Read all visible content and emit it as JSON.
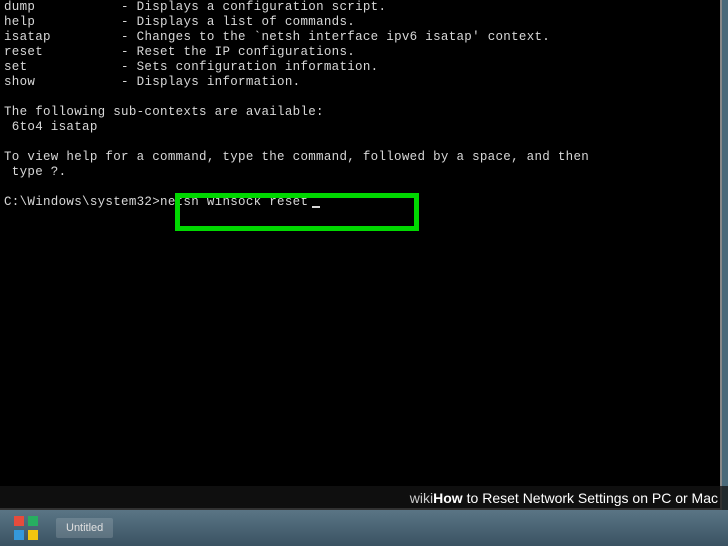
{
  "terminal": {
    "help_lines": [
      {
        "cmd": "dump",
        "desc": "Displays a configuration script."
      },
      {
        "cmd": "help",
        "desc": "Displays a list of commands."
      },
      {
        "cmd": "isatap",
        "desc": "Changes to the `netsh interface ipv6 isatap' context."
      },
      {
        "cmd": "reset",
        "desc": "Reset the IP configurations."
      },
      {
        "cmd": "set",
        "desc": "Sets configuration information."
      },
      {
        "cmd": "show",
        "desc": "Displays information."
      }
    ],
    "subcontext_header": "The following sub-contexts are available:",
    "subcontext_list": " 6to4 isatap",
    "view_help_line1": "To view help for a command, type the command, followed by a space, and then",
    "view_help_line2": " type ?.",
    "prompt": "C:\\Windows\\system32>",
    "command": "netsh winsock reset"
  },
  "caption": {
    "wiki": "wiki",
    "how": "How",
    "article": " to Reset Network Settings on PC or Mac"
  },
  "taskbar": {
    "item_label": "Untitled"
  }
}
